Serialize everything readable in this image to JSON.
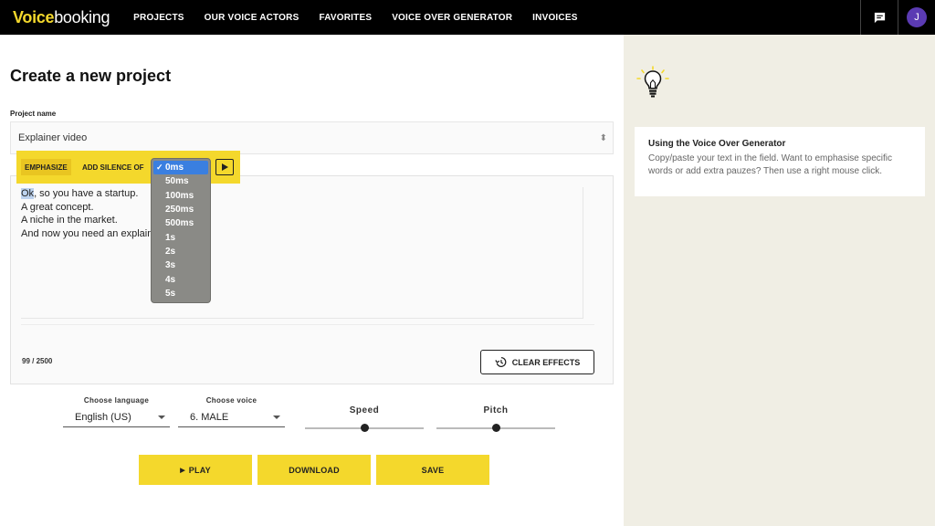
{
  "nav": {
    "logo_prefix": "Voice",
    "logo_suffix": "booking",
    "links": [
      "PROJECTS",
      "OUR VOICE ACTORS",
      "FAVORITES",
      "VOICE OVER GENERATOR",
      "INVOICES"
    ],
    "avatar_initial": "J"
  },
  "main": {
    "title": "Create a new project",
    "project_name_label": "Project name",
    "project_name_value": "Explainer video"
  },
  "toolbar": {
    "emphasize": "EMPHASIZE",
    "silence_label": "ADD SILENCE OF"
  },
  "silence_dropdown": {
    "selected": "0ms",
    "options": [
      "0ms",
      "50ms",
      "100ms",
      "250ms",
      "500ms",
      "1s",
      "2s",
      "3s",
      "4s",
      "5s"
    ]
  },
  "editor": {
    "line1_hl": "Ok",
    "line1_rest": ", so you have a startup.",
    "line2": "A great concept.",
    "line3": "A niche in the market.",
    "line4": "And now you need an explainer",
    "counter": "99 / 2500",
    "clear_label": "CLEAR EFFECTS"
  },
  "controls": {
    "language_label": "Choose language",
    "language_value": "English (US)",
    "voice_label": "Choose voice",
    "voice_value": "6. MALE",
    "speed_label": "Speed",
    "speed_value": 0.5,
    "pitch_label": "Pitch",
    "pitch_value": 0.5
  },
  "actions": {
    "play": "PLAY",
    "download": "DOWNLOAD",
    "save": "SAVE"
  },
  "tip": {
    "title": "Using the Voice Over Generator",
    "text": "Copy/paste your text in the field. Want to emphasise specific words or add extra pauzes? Then use a right mouse click."
  },
  "colors": {
    "accent": "#f4d82c",
    "nav_bg": "#000000",
    "panel_bg": "#f0eee4",
    "avatar": "#5b3bb3",
    "select_blue": "#3a7fe0"
  }
}
